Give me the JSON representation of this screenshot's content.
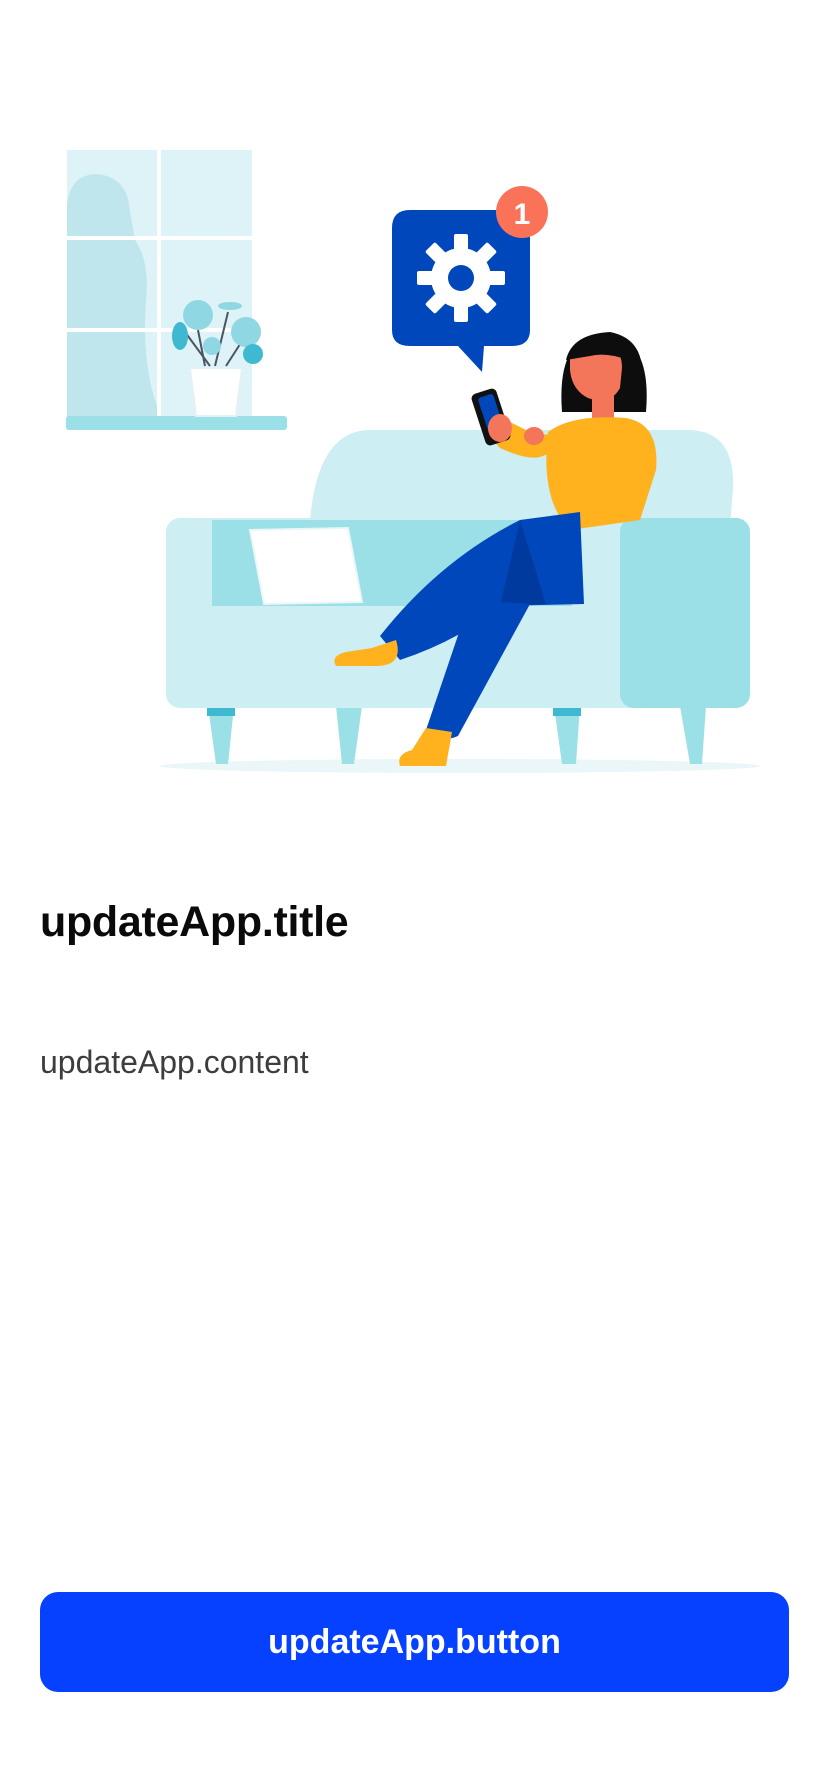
{
  "illustration": {
    "name": "person-on-sofa-with-settings-notification",
    "notification_count": "1",
    "colors": {
      "blue": "#0047BB",
      "sky": "#CDEEF3",
      "sky_dark": "#9BDFE7",
      "yellow": "#FFB21E",
      "skin": "#F4765A",
      "badge": "#FA7359"
    }
  },
  "update_app": {
    "title": "updateApp.title",
    "content": "updateApp.content",
    "button": "updateApp.button"
  },
  "colors": {
    "accent": "#0541FF",
    "title": "#0A0A0A",
    "body_text": "#3D3D3D",
    "background": "#FFFFFF"
  }
}
